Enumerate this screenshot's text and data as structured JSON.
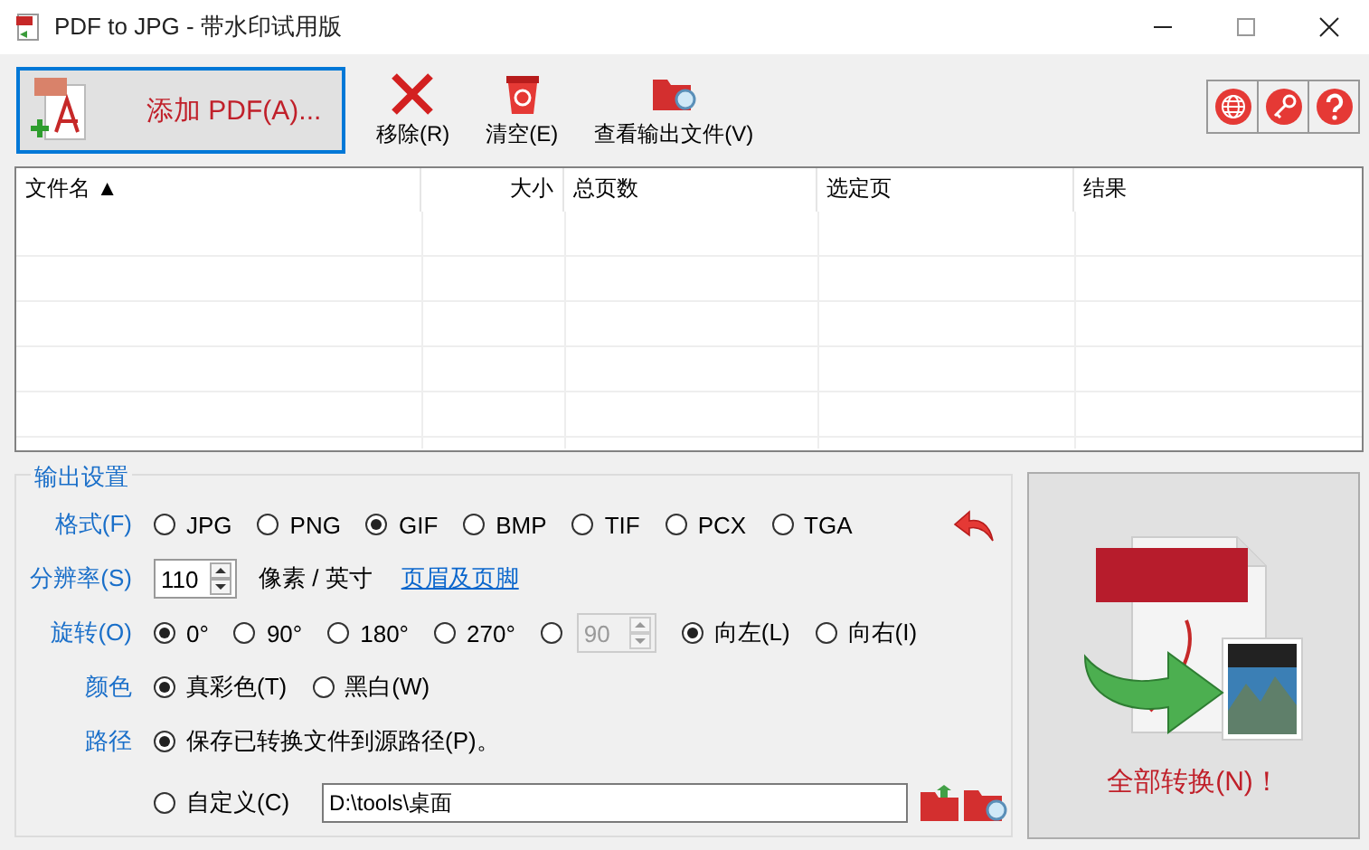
{
  "window": {
    "title": "PDF to JPG - 带水印试用版"
  },
  "toolbar": {
    "buttons": [
      {
        "kind": "add",
        "label": "添加 PDF(A)...",
        "focused": true
      },
      {
        "kind": "remove",
        "label": "移除(R)",
        "focused": false
      },
      {
        "kind": "clear",
        "label": "清空(E)",
        "focused": false
      },
      {
        "kind": "view",
        "label": "查看输出文件(V)",
        "focused": false
      }
    ]
  },
  "table": {
    "columns": [
      {
        "label": "文件名 ▲"
      },
      {
        "label": "大小"
      },
      {
        "label": "总页数"
      },
      {
        "label": "选定页"
      },
      {
        "label": "结果"
      }
    ]
  },
  "settings": {
    "title": "输出设置",
    "format": {
      "label": "格式(F)",
      "options": [
        {
          "label": "JPG",
          "selected": false
        },
        {
          "label": "PNG",
          "selected": false
        },
        {
          "label": "GIF",
          "selected": true
        },
        {
          "label": "BMP",
          "selected": false
        },
        {
          "label": "TIF",
          "selected": false
        },
        {
          "label": "PCX",
          "selected": false
        },
        {
          "label": "TGA",
          "selected": false
        }
      ]
    },
    "resolution": {
      "label": "分辨率(S)",
      "value": "110",
      "unit": "像素 / 英寸",
      "link": "页眉及页脚"
    },
    "rotation": {
      "label": "旋转(O)",
      "options": [
        {
          "kind": "fixed",
          "label": "0°",
          "selected": true
        },
        {
          "kind": "fixed",
          "label": "90°",
          "selected": false
        },
        {
          "kind": "fixed",
          "label": "180°",
          "selected": false
        },
        {
          "kind": "fixed",
          "label": "270°",
          "selected": false
        },
        {
          "kind": "custom",
          "value": "90",
          "disabled": true,
          "selected": false
        }
      ],
      "direction": [
        {
          "label": "向左(L)",
          "selected": true
        },
        {
          "label": "向右(I)",
          "selected": false
        }
      ]
    },
    "color": {
      "label": "颜色",
      "options": [
        {
          "label": "真彩色(T)",
          "selected": true
        },
        {
          "label": "黑白(W)",
          "selected": false
        }
      ]
    },
    "path": {
      "label": "路径",
      "options": [
        {
          "label": "保存已转换文件到源路径(P)。",
          "selected": true
        },
        {
          "label": "自定义(C)",
          "selected": false
        }
      ],
      "value": "D:\\tools\\桌面"
    }
  },
  "convert": {
    "label": "全部转换(N)！"
  }
}
